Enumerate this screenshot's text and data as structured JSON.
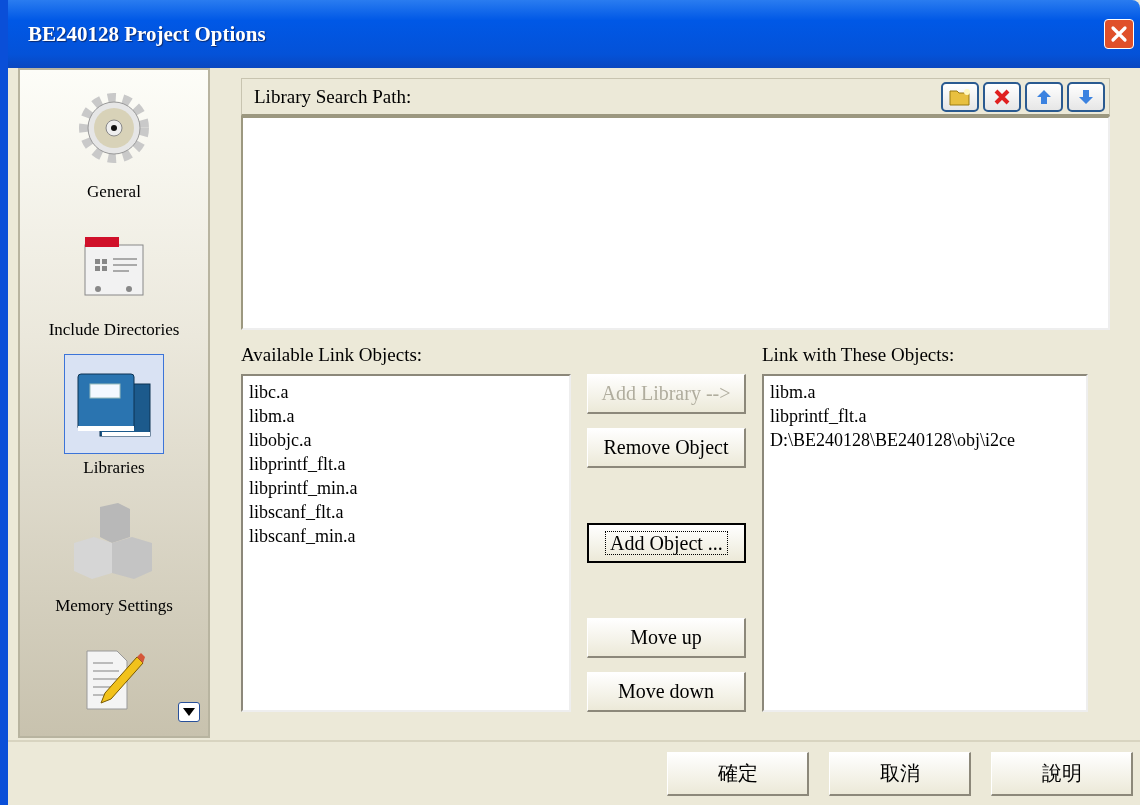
{
  "window": {
    "title": "BE240128 Project Options"
  },
  "sidebar": {
    "items": [
      {
        "kind": "gear",
        "label": "General",
        "selected": false
      },
      {
        "kind": "include",
        "label": "Include Directories",
        "selected": false
      },
      {
        "kind": "books",
        "label": "Libraries",
        "selected": true
      },
      {
        "kind": "cubes",
        "label": "Memory Settings",
        "selected": false
      },
      {
        "kind": "pencil",
        "selected": false
      }
    ]
  },
  "search_path": {
    "label": "Library Search Path:",
    "tools": [
      {
        "kind": "folder"
      },
      {
        "kind": "delete"
      },
      {
        "kind": "up"
      },
      {
        "kind": "down"
      }
    ]
  },
  "available": {
    "label": "Available Link Objects:",
    "items": [
      "libc.a",
      "libm.a",
      "libobjc.a",
      "libprintf_flt.a",
      "libprintf_min.a",
      "libscanf_flt.a",
      "libscanf_min.a"
    ]
  },
  "actions": [
    {
      "label": "Add Library -->",
      "disabled": true,
      "default": false
    },
    {
      "label": "Remove Object",
      "disabled": false,
      "default": false
    },
    {
      "label": "Add Object ...",
      "disabled": false,
      "default": true
    },
    {
      "label": "Move up",
      "disabled": false,
      "default": false
    },
    {
      "label": "Move down",
      "disabled": false,
      "default": false
    }
  ],
  "linked": {
    "label": "Link with These Objects:",
    "items": [
      "libm.a",
      "libprintf_flt.a",
      "D:\\BE240128\\BE240128\\obj\\i2ce"
    ]
  },
  "buttons": [
    "確定",
    "取消",
    "說明"
  ]
}
